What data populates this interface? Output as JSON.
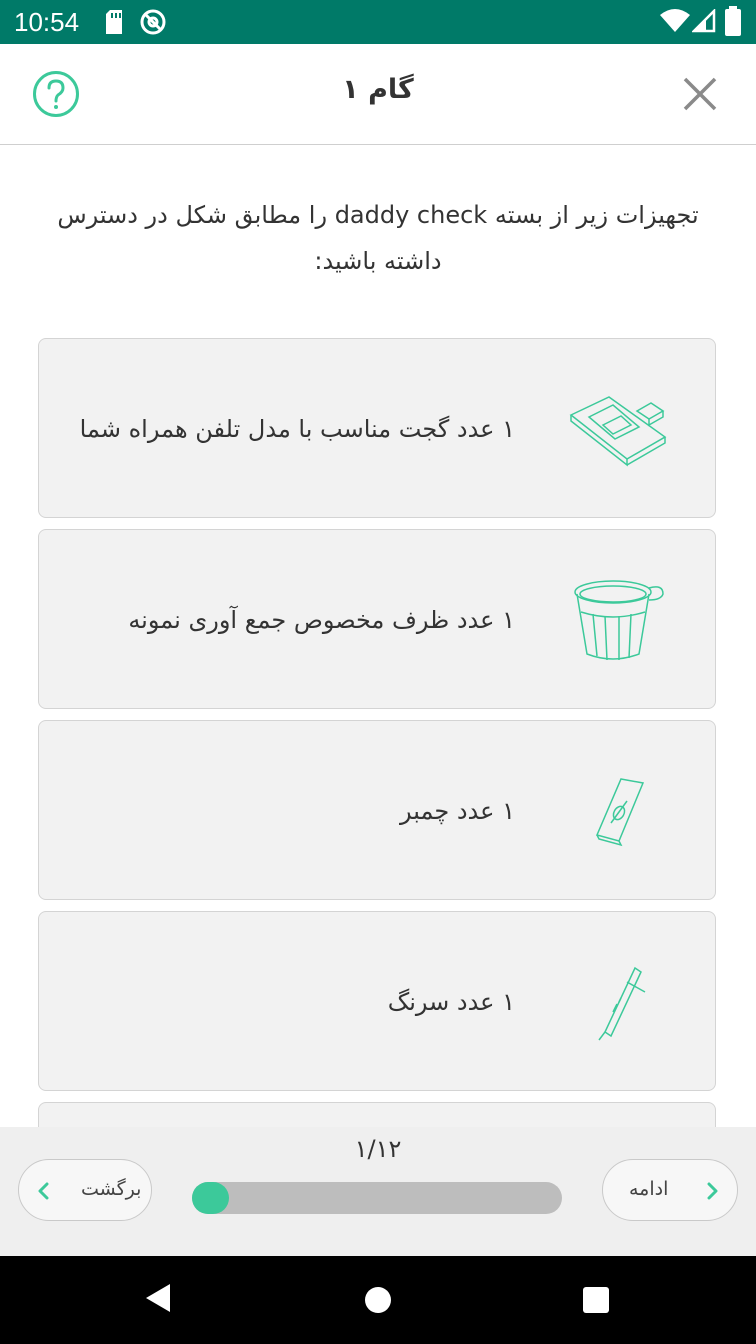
{
  "status_bar": {
    "time": "10:54"
  },
  "header": {
    "title": "گام ۱"
  },
  "instruction": "تجهیزات زیر از بسته daddy check را مطابق شکل در دسترس داشته باشید:",
  "items": [
    {
      "label": "۱ عدد گجت مناسب با مدل تلفن همراه شما",
      "icon": "gadget-icon"
    },
    {
      "label": "۱ عدد ظرف مخصوص جمع آوری نمونه",
      "icon": "cup-icon"
    },
    {
      "label": "۱ عدد چمبر",
      "icon": "chamber-icon"
    },
    {
      "label": "۱ عدد سرنگ",
      "icon": "syringe-icon"
    }
  ],
  "footer": {
    "step_counter": "۱/۱۲",
    "progress": 0.083,
    "back_label": "برگشت",
    "next_label": "ادامه"
  },
  "colors": {
    "status": "#007a68",
    "accent": "#3cc99a"
  }
}
